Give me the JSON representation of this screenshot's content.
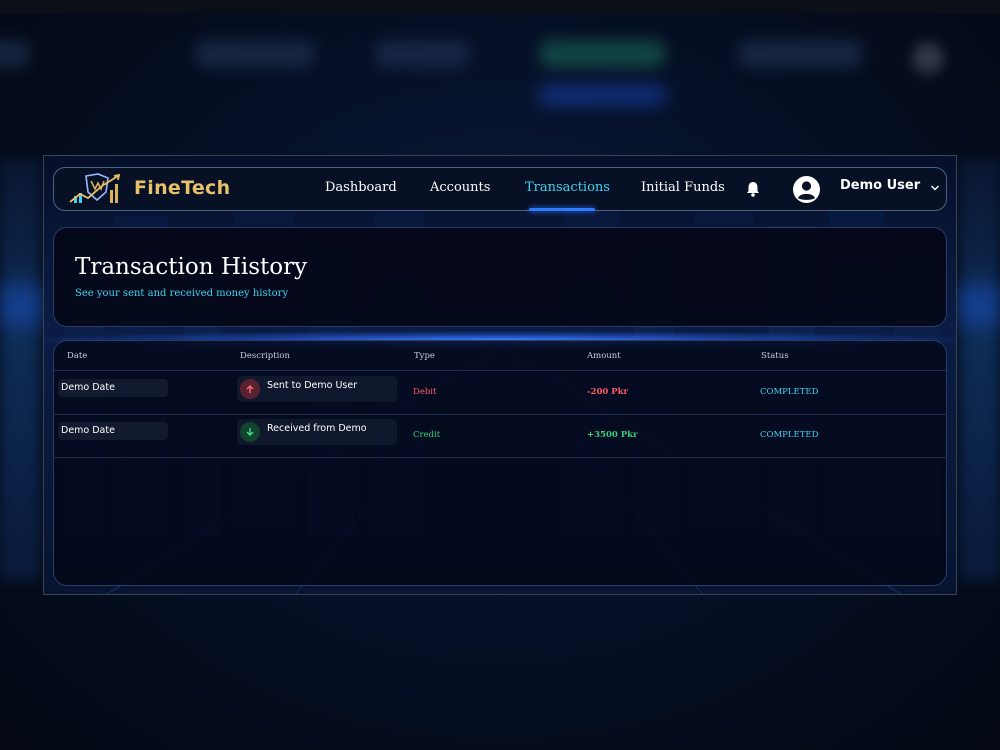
{
  "brand": {
    "name": "FineTech"
  },
  "nav": {
    "links": [
      {
        "label": "Dashboard",
        "active": false
      },
      {
        "label": "Accounts",
        "active": false
      },
      {
        "label": "Transactions",
        "active": true
      },
      {
        "label": "Initial Funds",
        "active": false
      }
    ],
    "icons": {
      "notifications": "bell-icon",
      "user": "user-avatar-icon",
      "menu": "chevron-down-icon"
    }
  },
  "user": {
    "name": "Demo User"
  },
  "page": {
    "title": "Transaction History",
    "subtitle": "See your sent and received money history"
  },
  "table": {
    "columns": [
      "Date",
      "Description",
      "Type",
      "Amount",
      "Status"
    ],
    "rows": [
      {
        "date": "Demo Date",
        "description": "Sent to Demo User",
        "direction_icon": "arrow-up-icon",
        "type": "Debit",
        "amount": "-200 Pkr",
        "status": "COMPLETED"
      },
      {
        "date": "Demo Date",
        "description": "Received from Demo",
        "direction_icon": "arrow-down-icon",
        "type": "Credit",
        "amount": "+3500 Pkr",
        "status": "COMPLETED"
      }
    ]
  },
  "colors": {
    "accent": "#3fd2f0",
    "brand_gold": "#e6c06a",
    "debit": "#ff5c6a",
    "credit": "#36d07a",
    "active_underline": "#2f7bff"
  }
}
